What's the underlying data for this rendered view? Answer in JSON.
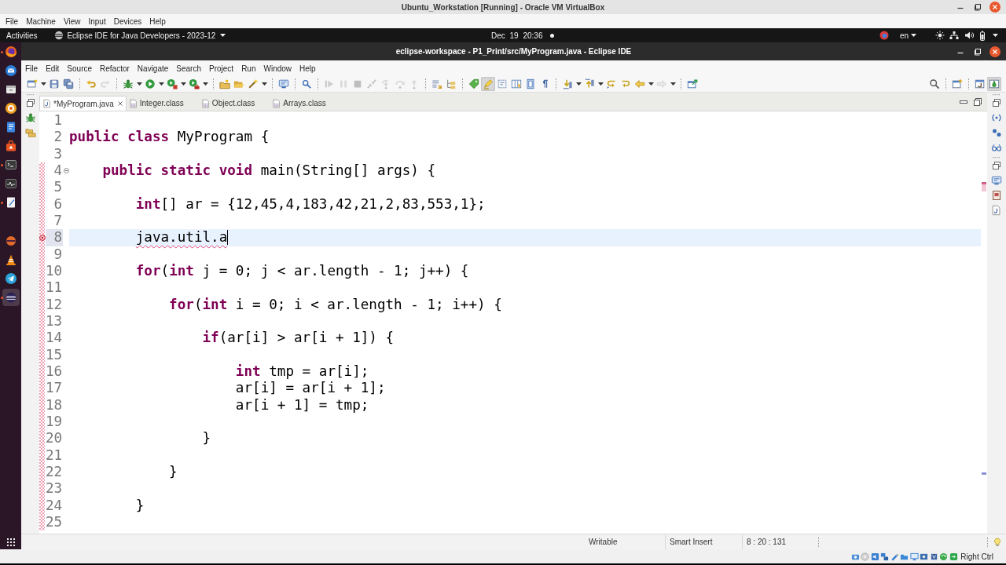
{
  "host_window": {
    "title": "Ubuntu_Workstation [Running] - Oracle VM VirtualBox",
    "menu": [
      "File",
      "Machine",
      "View",
      "Input",
      "Devices",
      "Help"
    ]
  },
  "top_bar": {
    "activities": "Activities",
    "app_menu": "Eclipse IDE for Java Developers - 2023-12",
    "clock": "Dec 19 20:36",
    "notification": true,
    "input_source": "en"
  },
  "dock": {
    "favorites": [
      {
        "kind": "browser",
        "running": true,
        "selected": false
      },
      {
        "kind": "mail",
        "running": false,
        "selected": false
      },
      {
        "kind": "box",
        "running": false,
        "selected": false
      },
      {
        "kind": "ring",
        "running": false,
        "selected": false
      },
      {
        "kind": "document",
        "running": false,
        "selected": false
      },
      {
        "kind": "bag",
        "running": false,
        "selected": false
      },
      {
        "kind": "terminal",
        "running": true,
        "selected": false
      },
      {
        "kind": "pulse",
        "running": false,
        "selected": false
      },
      {
        "kind": "notepad",
        "running": true,
        "selected": false
      }
    ],
    "others": [
      {
        "kind": "disc",
        "running": false,
        "selected": false
      },
      {
        "kind": "cone",
        "running": false,
        "selected": false
      },
      {
        "kind": "plane",
        "running": false,
        "selected": false
      },
      {
        "kind": "eclipse",
        "running": true,
        "selected": true
      }
    ]
  },
  "eclipse": {
    "title": "eclipse-workspace - P1_Print/src/MyProgram.java - Eclipse IDE",
    "menu": [
      "File",
      "Edit",
      "Source",
      "Refactor",
      "Navigate",
      "Search",
      "Project",
      "Run",
      "Window",
      "Help"
    ],
    "toolbar": {
      "groups": [
        {
          "buttons": [
            {
              "kind": "new",
              "dropdown": true,
              "disabled": false,
              "pressed": false
            },
            {
              "kind": "save",
              "dropdown": false,
              "disabled": false,
              "pressed": false
            },
            {
              "kind": "saveall",
              "dropdown": false,
              "disabled": false,
              "pressed": false
            }
          ]
        },
        {
          "buttons": [
            {
              "kind": "undo",
              "dropdown": false,
              "disabled": false,
              "pressed": false
            },
            {
              "kind": "redo",
              "dropdown": false,
              "disabled": true,
              "pressed": false
            }
          ]
        },
        {
          "buttons": [
            {
              "kind": "debug",
              "dropdown": true,
              "disabled": false,
              "pressed": false
            },
            {
              "kind": "run",
              "dropdown": true,
              "disabled": false,
              "pressed": false
            },
            {
              "kind": "coverage",
              "dropdown": true,
              "disabled": false,
              "pressed": false
            },
            {
              "kind": "external",
              "dropdown": true,
              "disabled": false,
              "pressed": false
            }
          ]
        },
        {
          "buttons": [
            {
              "kind": "newpackage",
              "dropdown": false,
              "disabled": false,
              "pressed": false
            },
            {
              "kind": "folder",
              "dropdown": false,
              "disabled": false,
              "pressed": false
            },
            {
              "kind": "wand",
              "dropdown": true,
              "disabled": false,
              "pressed": false
            }
          ]
        },
        {
          "buttons": [
            {
              "kind": "screen",
              "dropdown": false,
              "disabled": false,
              "pressed": false
            }
          ]
        },
        {
          "buttons": [
            {
              "kind": "magnifier",
              "dropdown": false,
              "disabled": false,
              "pressed": false
            }
          ]
        },
        {
          "buttons": [
            {
              "kind": "resume",
              "dropdown": false,
              "disabled": true,
              "pressed": false
            },
            {
              "kind": "suspend",
              "dropdown": false,
              "disabled": true,
              "pressed": false
            },
            {
              "kind": "terminate",
              "dropdown": false,
              "disabled": true,
              "pressed": false
            },
            {
              "kind": "disconnect",
              "dropdown": false,
              "disabled": true,
              "pressed": false
            },
            {
              "kind": "stepinto",
              "dropdown": false,
              "disabled": true,
              "pressed": false
            },
            {
              "kind": "stepover",
              "dropdown": false,
              "disabled": true,
              "pressed": false
            },
            {
              "kind": "stepreturn",
              "dropdown": false,
              "disabled": true,
              "pressed": false
            }
          ]
        },
        {
          "buttons": [
            {
              "kind": "lines",
              "dropdown": false,
              "disabled": false,
              "pressed": false
            },
            {
              "kind": "tree",
              "dropdown": false,
              "disabled": false,
              "pressed": false
            }
          ]
        },
        {
          "buttons": [
            {
              "kind": "tag",
              "dropdown": false,
              "disabled": false,
              "pressed": false
            },
            {
              "kind": "highlighter",
              "dropdown": false,
              "disabled": false,
              "pressed": true
            },
            {
              "kind": "block",
              "dropdown": false,
              "disabled": false,
              "pressed": false
            },
            {
              "kind": "columns",
              "dropdown": false,
              "disabled": false,
              "pressed": false
            },
            {
              "kind": "frame",
              "dropdown": false,
              "disabled": false,
              "pressed": false
            },
            {
              "kind": "pilcrow",
              "dropdown": false,
              "disabled": false,
              "pressed": false
            }
          ]
        },
        {
          "buttons": [
            {
              "kind": "nextann",
              "dropdown": true,
              "disabled": false,
              "pressed": false
            },
            {
              "kind": "prevann",
              "dropdown": true,
              "disabled": false,
              "pressed": false
            },
            {
              "kind": "lastedit",
              "dropdown": false,
              "disabled": false,
              "pressed": false
            },
            {
              "kind": "returnarrow",
              "dropdown": false,
              "disabled": false,
              "pressed": false
            },
            {
              "kind": "back",
              "dropdown": true,
              "disabled": false,
              "pressed": false
            },
            {
              "kind": "forward",
              "dropdown": true,
              "disabled": true,
              "pressed": false
            }
          ]
        },
        {
          "buttons": [
            {
              "kind": "openwindow",
              "dropdown": false,
              "disabled": false,
              "pressed": false
            }
          ]
        }
      ],
      "right_groups": [
        {
          "buttons": [
            {
              "kind": "search",
              "dropdown": false,
              "disabled": false,
              "pressed": false
            }
          ]
        },
        {
          "buttons": [
            {
              "kind": "windowplus",
              "dropdown": false,
              "disabled": false,
              "pressed": false
            }
          ]
        },
        {
          "buttons": [
            {
              "kind": "java",
              "dropdown": false,
              "disabled": false,
              "pressed": false
            },
            {
              "kind": "debugp",
              "dropdown": false,
              "disabled": false,
              "pressed": true
            }
          ]
        }
      ]
    },
    "tabs": [
      {
        "label": "*MyProgram.java",
        "kind": "source",
        "selected": true
      },
      {
        "label": "Integer.class",
        "kind": "class",
        "selected": false
      },
      {
        "label": "Object.class",
        "kind": "class",
        "selected": false
      },
      {
        "label": "Arrays.class",
        "kind": "class",
        "selected": false
      }
    ],
    "editor": {
      "lines": [
        {
          "number": "1",
          "in_range": false,
          "fold": false,
          "error": false,
          "current": false
        },
        {
          "number": "2",
          "code": "**public** **class** MyProgram {",
          "in_range": false,
          "fold": false,
          "error": false,
          "current": false
        },
        {
          "number": "3",
          "in_range": false,
          "fold": false,
          "error": false,
          "current": false
        },
        {
          "number": "4",
          "code": "    **public** **static** **void** main(String[] args) {",
          "in_range": true,
          "fold": true,
          "error": false,
          "current": false,
          "children": [
            {
              "number": "5",
              "fold": false,
              "error": false,
              "current": false
            },
            {
              "number": "6",
              "code": "        **int**[] ar = {12,45,4,183,42,21,2,83,553,1};",
              "fold": false,
              "error": false,
              "current": false
            },
            {
              "number": "7",
              "fold": false,
              "error": false,
              "current": false
            },
            {
              "number": "8",
              "code": "        java.util.a",
              "fold": false,
              "error": true,
              "current": true
            },
            {
              "number": "9",
              "fold": false,
              "error": false,
              "current": false
            },
            {
              "number": "10",
              "code": "        **for**(**int** j = 0; j < ar.length - 1; j++) {",
              "fold": false,
              "error": false,
              "current": false
            },
            {
              "number": "11",
              "fold": false,
              "error": false,
              "current": false
            },
            {
              "number": "12",
              "code": "            **for**(**int** i = 0; i < ar.length - 1; i++) {",
              "fold": false,
              "error": false,
              "current": false
            },
            {
              "number": "13",
              "fold": false,
              "error": false,
              "current": false
            },
            {
              "number": "14",
              "code": "                **if**(ar[i] > ar[i + 1]) {",
              "fold": false,
              "error": false,
              "current": false
            },
            {
              "number": "15",
              "fold": false,
              "error": false,
              "current": false
            },
            {
              "number": "16",
              "code": "                    **int** tmp = ar[i];",
              "fold": false,
              "error": false,
              "current": false
            },
            {
              "number": "17",
              "code": "                    ar[i] = ar[i + 1];",
              "fold": false,
              "error": false,
              "current": false
            },
            {
              "number": "18",
              "code": "                    ar[i + 1] = tmp;",
              "fold": false,
              "error": false,
              "current": false
            },
            {
              "number": "19",
              "fold": false,
              "error": false,
              "current": false
            },
            {
              "number": "20",
              "code": "                }",
              "fold": false,
              "error": false,
              "current": false
            },
            {
              "number": "21",
              "fold": false,
              "error": false,
              "current": false
            },
            {
              "number": "22",
              "code": "            }",
              "fold": false,
              "error": false,
              "current": false
            },
            {
              "number": "23",
              "fold": false,
              "error": false,
              "current": false
            },
            {
              "number": "24",
              "code": "        }",
              "fold": false,
              "error": false,
              "current": false
            },
            {
              "number": "25",
              "fold": false,
              "error": false,
              "current": false
            }
          ]
        }
      ]
    },
    "status_bar": {
      "fields": [
        "Writable",
        "Smart Insert",
        "8 : 20 : 131"
      ]
    }
  },
  "host_status": {
    "host_key": "Right Ctrl"
  }
}
